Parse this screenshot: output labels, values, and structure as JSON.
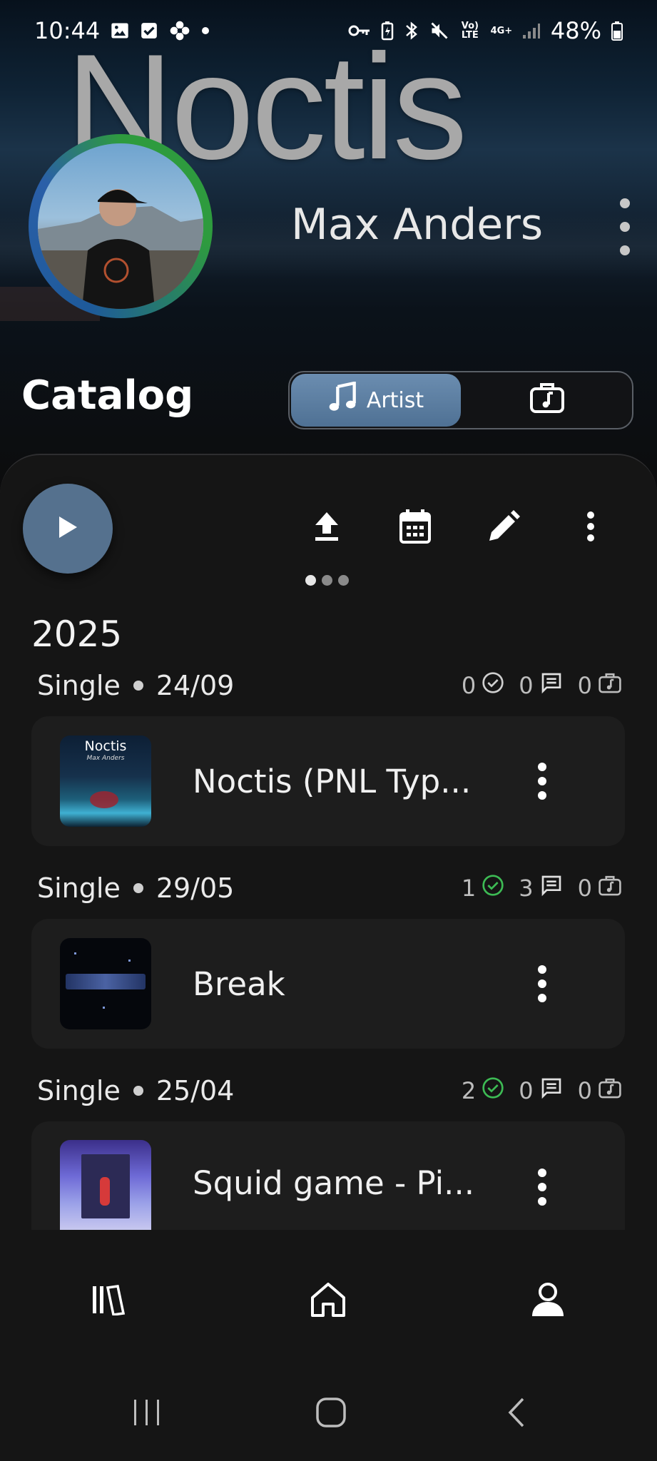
{
  "status_bar": {
    "time": "10:44",
    "left_icons": [
      "gallery-icon",
      "checkbox-icon",
      "flower-icon",
      "notification-dot-icon"
    ],
    "right_icons": [
      "key-icon",
      "battery-saver-icon",
      "bluetooth-icon",
      "mute-icon",
      "volte-icon",
      "4g-icon",
      "signal-icon"
    ],
    "volte_label": "Vo) LTE",
    "network_label": "4G+",
    "battery": "48%"
  },
  "header": {
    "big_title": "Noctis",
    "artist_name": "Max Anders"
  },
  "catalog": {
    "title": "Catalog",
    "segments": [
      {
        "label": "Artist",
        "icon": "music-note-icon",
        "active": true
      },
      {
        "label": "",
        "icon": "music-briefcase-icon",
        "active": false
      }
    ]
  },
  "toolbar": {
    "icons": [
      "play-icon",
      "upload-icon",
      "calendar-icon",
      "edit-icon",
      "more-vert-icon"
    ],
    "pager": {
      "count": 3,
      "active_index": 0
    }
  },
  "year": "2025",
  "releases": [
    {
      "type": "Single",
      "date": "24/09",
      "approved": "0",
      "approved_color": "#cfcfcf",
      "comments": "0",
      "deals": "0",
      "title": "Noctis (PNL Typ...",
      "cover_text": "Noctis",
      "cover_sub": "Max Anders"
    },
    {
      "type": "Single",
      "date": "29/05",
      "approved": "1",
      "approved_color": "#3dbb54",
      "comments": "3",
      "deals": "0",
      "title": "Break",
      "cover_text": "",
      "cover_sub": ""
    },
    {
      "type": "Single",
      "date": "25/04",
      "approved": "2",
      "approved_color": "#3dbb54",
      "comments": "0",
      "deals": "0",
      "title": "Squid game - Pi...",
      "cover_text": "",
      "cover_sub": ""
    }
  ],
  "bottom_nav": {
    "items": [
      "library-icon",
      "home-icon",
      "profile-icon"
    ],
    "active": "profile-icon"
  },
  "system_nav": [
    "recents-icon",
    "home-button-icon",
    "back-icon"
  ],
  "colors": {
    "accent": "#55718e",
    "approved_green": "#3dbb54",
    "card_bg": "#1d1d1d",
    "page_bg": "#151515"
  }
}
